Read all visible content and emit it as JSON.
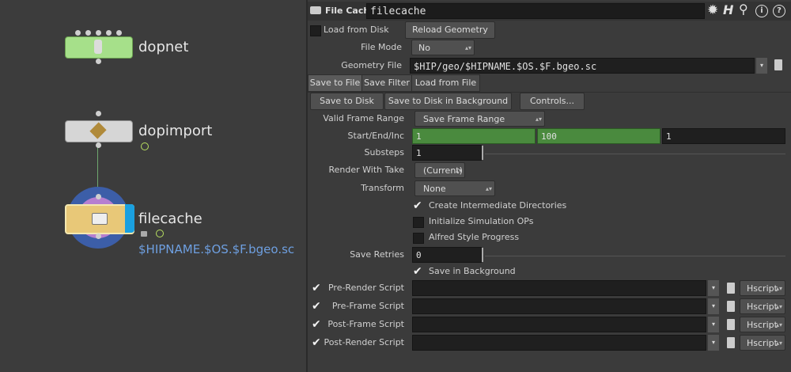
{
  "network": {
    "nodes": [
      {
        "name": "dopnet",
        "color": "#a6e08a"
      },
      {
        "name": "dopimport",
        "color": "#d6d6d6"
      },
      {
        "name": "filecache",
        "color": "#e8c878",
        "path": "$HIPNAME.$OS.$F.bgeo.sc"
      }
    ]
  },
  "header": {
    "node_type": "File Cache",
    "node_name": "filecache"
  },
  "params": {
    "load_from_disk_label": "Load from Disk",
    "reload_geometry_label": "Reload Geometry",
    "file_mode_label": "File Mode",
    "file_mode_value": "No Operation",
    "geometry_file_label": "Geometry File",
    "geometry_file_value": "$HIP/geo/$HIPNAME.$OS.$F.bgeo.sc",
    "tabs": [
      "Save to File",
      "Save Filter",
      "Load from File"
    ],
    "save_to_disk_label": "Save to Disk",
    "save_to_disk_bg_label": "Save to Disk in Background",
    "controls_label": "Controls...",
    "valid_frame_range_label": "Valid Frame Range",
    "valid_frame_range_value": "Save Frame Range",
    "start_end_inc_label": "Start/End/Inc",
    "start_value": "1",
    "end_value": "100",
    "inc_value": "1",
    "substeps_label": "Substeps",
    "substeps_value": "1",
    "render_with_take_label": "Render With Take",
    "render_with_take_value": "(Current)",
    "transform_label": "Transform",
    "transform_value": "None",
    "create_dirs_label": "Create Intermediate Directories",
    "init_sim_label": "Initialize Simulation OPs",
    "alfred_label": "Alfred Style Progress",
    "save_retries_label": "Save Retries",
    "save_retries_value": "0",
    "save_in_bg_label": "Save in Background",
    "scripts": [
      {
        "label": "Pre-Render Script",
        "lang": "Hscript"
      },
      {
        "label": "Pre-Frame Script",
        "lang": "Hscript"
      },
      {
        "label": "Post-Frame Script",
        "lang": "Hscript"
      },
      {
        "label": "Post-Render Script",
        "lang": "Hscript"
      }
    ]
  },
  "colors": {
    "range_green": "#4a8a3e",
    "path_blue": "#6e9fe0"
  }
}
